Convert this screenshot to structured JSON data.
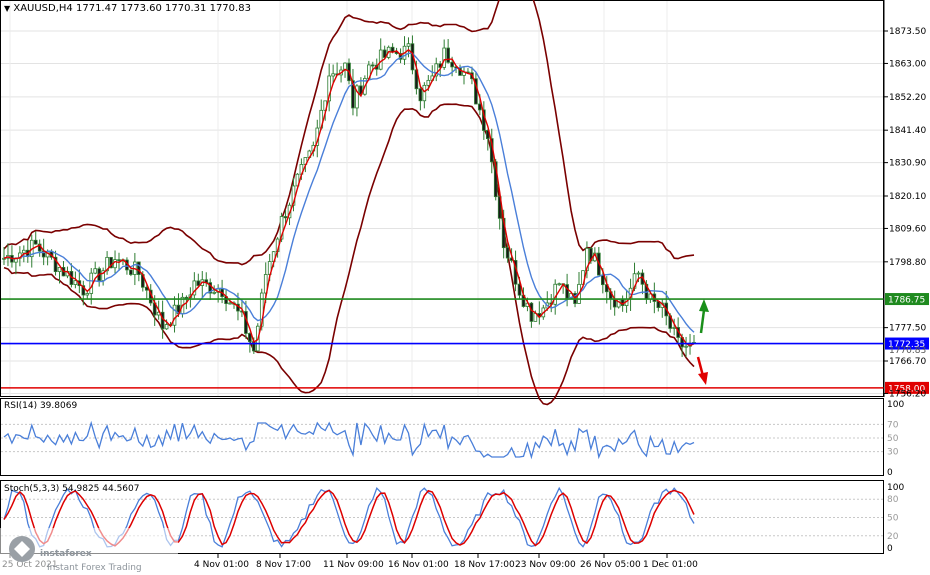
{
  "chart_data": {
    "type": "candlestick",
    "header": {
      "symbol": "XAUUSD,H4",
      "quote": "1771.47 1773.60 1770.31 1770.83"
    },
    "price_axis": {
      "ticks": [
        "1873.50",
        "1863.00",
        "1852.20",
        "1841.40",
        "1830.90",
        "1820.10",
        "1809.60",
        "1798.80",
        "1777.50",
        "1766.70",
        "1756.20"
      ],
      "range": [
        1756.2,
        1878.0
      ]
    },
    "levels": [
      {
        "name": "resistance",
        "value": "1786.75",
        "color": "#1f8a1f"
      },
      {
        "name": "current",
        "value": "1772.35",
        "color": "#0000ff"
      },
      {
        "name": "support",
        "value": "1758.00",
        "color": "#e00000"
      }
    ],
    "current_price": "1770.83",
    "series": [
      {
        "type": "candles",
        "color_up": "#2e7d32",
        "color_down": "#2e7d32"
      },
      {
        "type": "bollinger",
        "color": "#7a0000"
      },
      {
        "type": "ma_fast",
        "color": "#dd0000"
      },
      {
        "type": "ma_slow",
        "color": "#4a7fd9"
      }
    ],
    "trend_arrows": [
      {
        "direction": "up",
        "color": "#1a8f1a"
      },
      {
        "direction": "down",
        "color": "#e00000"
      }
    ],
    "x_axis": {
      "ticks": [
        "25 Oct 2021",
        "4 Nov 01:00",
        "8 Nov 17:00",
        "11 Nov 09:00",
        "16 Nov 01:00",
        "18 Nov 17:00",
        "23 Nov 09:00",
        "26 Nov 05:00",
        "1 Dec 01:00"
      ]
    },
    "rsi": {
      "label": "RSI(14) 39.8069",
      "ticks": [
        "100",
        "70",
        "50",
        "30",
        "0"
      ],
      "color": "#4a7fd9"
    },
    "stoch": {
      "label": "Stoch(5,3,3) 54.9825 44.5607",
      "ticks": [
        "100",
        "80",
        "50",
        "20",
        "0"
      ],
      "colors": [
        "#4a7fd9",
        "#dd0000"
      ]
    }
  },
  "watermark": {
    "brand": "instaforex",
    "tagline": "Instant Forex Trading"
  }
}
